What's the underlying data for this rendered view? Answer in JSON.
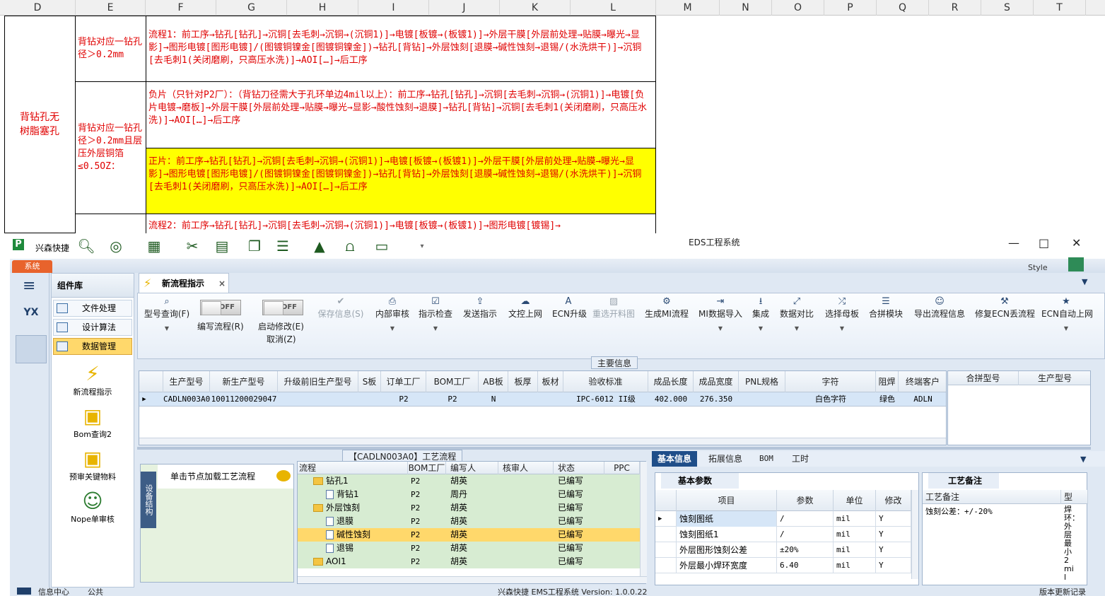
{
  "excel": {
    "columns": [
      "D",
      "E",
      "F",
      "G",
      "H",
      "I",
      "J",
      "K",
      "L",
      "M",
      "N",
      "O",
      "P",
      "Q",
      "R",
      "S",
      "T"
    ],
    "merged_label": "背钻孔无树脂塞孔",
    "rows": [
      {
        "cond": "背钻对应一钻孔径＞0.2mm",
        "flow": "流程1：前工序→钻孔[钻孔]→沉铜[去毛刺→沉铜→(沉铜1)]→电镀[板镀→(板镀1)]→外层干膜[外层前处理→贴膜→曝光→显影]→图形电镀[图形电镀]/(图镀铜镍金[图镀铜镍金])→钻孔[背钻]→外层蚀刻[退膜→碱性蚀刻→退锡/(水洗烘干)]→沉铜[去毛刺1(关闭磨刷，只高压水洗)]→AOI[…]→后工序"
      },
      {
        "cond": "背钻对应一钻孔径＞0.2mm且层压外层铜箔≤0.5OZ：",
        "flow": "负片（只针对P2厂）：（背钻刀径需大于孔环单边4mil以上）：前工序→钻孔[钻孔]→沉铜[去毛刺→沉铜→(沉铜1)]→电镀[负片电镀→磨板]→外层干膜[外层前处理→贴膜→曝光→显影→酸性蚀刻→退膜]→钻孔[背钻]→沉铜[去毛刺1(关闭磨刷，只高压水洗)]→AOI[…]→后工序"
      },
      {
        "cond": "",
        "flow": "正片：前工序→钻孔[钻孔]→沉铜[去毛刺→沉铜→(沉铜1)]→电镀[板镀→(板镀1)]→外层干膜[外层前处理→贴膜→曝光→显影]→图形电镀[图形电镀]/(图镀铜镍金[图镀铜镍金])→钻孔[背钻]→外层蚀刻[退膜→碱性蚀刻→退锡/(水洗烘干)]→沉铜[去毛刺1(关闭磨刷，只高压水洗)]→AOI[…]→后工序"
      },
      {
        "cond": "",
        "flow": "流程2：前工序→钻孔[钻孔]→沉铜[去毛刺→沉铜→(沉铜1)]→电镀[板镀→(板镀1)]→图形电镀[镀锡]→"
      }
    ],
    "highlight_color": "#ffff00",
    "text_color": "#e00000"
  },
  "app": {
    "title": "EDS工程系统",
    "quick_label": "兴森快捷",
    "system_tab": "系统",
    "style_label": "Style",
    "component_lib": "组件库",
    "lib_items": [
      "文件处理",
      "设计算法",
      "数据管理"
    ],
    "lib_tools": [
      "新流程指示",
      "Bom查询2",
      "预审关键物料",
      "Nope单审核"
    ],
    "doc_tab": "新流程指示",
    "toolbar": {
      "query": "型号查询(F)",
      "edit_flow": "编写流程(R)",
      "start_modify": "启动修改(E)",
      "cancel": "取消(Z)",
      "toggle_off": "OFF",
      "buttons": [
        "保存信息(S)",
        "内部审核",
        "指示检查",
        "发送指示",
        "文控上网",
        "ECN升级",
        "重选开料图",
        "生成MI流程",
        "MI数据导入",
        "集成",
        "数据对比",
        "选择母板",
        "合拼模块",
        "导出流程信息",
        "修复ECN丢流程",
        "ECN自动上网"
      ]
    },
    "main_info": "主要信息",
    "main_grid": {
      "headers": [
        "生产型号",
        "新生产型号",
        "升级前旧生产型号",
        "S板",
        "订单工厂",
        "BOM工厂",
        "AB板",
        "板厚",
        "板材",
        "验收标准",
        "成品长度",
        "成品宽度",
        "PNL规格",
        "字符",
        "阻焊",
        "终端客户"
      ],
      "row": [
        "CADLN003A0",
        "10011200029047",
        "",
        "",
        "P2",
        "P2",
        "N",
        "",
        "",
        "IPC-6012 II级",
        "402.000",
        "276.350",
        "",
        "白色字符",
        "绿色",
        "ADLN"
      ]
    },
    "merge_grid": {
      "headers": [
        "合拼型号",
        "生产型号"
      ]
    },
    "flow_title": "【CADLN003A0】工艺流程",
    "device_structure": "设备结构",
    "node_hint": "单击节点加载工艺流程",
    "tree": {
      "headers": [
        "流程",
        "BOM工厂",
        "编写人",
        "核审人",
        "状态",
        "PPC"
      ],
      "rows": [
        {
          "name": "钻孔1",
          "factory": "P2",
          "writer": "胡英",
          "reviewer": "",
          "status": "已编写",
          "level": 0,
          "folder": true
        },
        {
          "name": "背钻1",
          "factory": "P2",
          "writer": "周丹",
          "reviewer": "",
          "status": "已编写",
          "level": 1,
          "folder": false
        },
        {
          "name": "外层蚀刻",
          "factory": "P2",
          "writer": "胡英",
          "reviewer": "",
          "status": "已编写",
          "level": 0,
          "folder": true
        },
        {
          "name": "退膜",
          "factory": "P2",
          "writer": "胡英",
          "reviewer": "",
          "status": "已编写",
          "level": 1,
          "folder": false
        },
        {
          "name": "碱性蚀刻",
          "factory": "P2",
          "writer": "胡英",
          "reviewer": "",
          "status": "已编写",
          "level": 1,
          "folder": false,
          "selected": true
        },
        {
          "name": "退锡",
          "factory": "P2",
          "writer": "胡英",
          "reviewer": "",
          "status": "已编写",
          "level": 1,
          "folder": false
        },
        {
          "name": "AOI1",
          "factory": "P2",
          "writer": "胡英",
          "reviewer": "",
          "status": "已编写",
          "level": 0,
          "folder": true
        }
      ]
    },
    "right_tabs": [
      "基本信息",
      "拓展信息",
      "BOM",
      "工时"
    ],
    "basic_params": "基本参数",
    "params": {
      "headers": [
        "项目",
        "参数",
        "单位",
        "修改"
      ],
      "rows": [
        [
          "蚀刻图纸",
          "/",
          "mil",
          "Y"
        ],
        [
          "蚀刻图纸1",
          "/",
          "mil",
          "Y"
        ],
        [
          "外层图形蚀刻公差",
          "±20%",
          "mil",
          "Y"
        ],
        [
          "外层最小焊环宽度",
          "6.40",
          "mil",
          "Y"
        ]
      ]
    },
    "process_notes_tab": "工艺备注",
    "process_notes_header": "工艺备注",
    "model_header": "型",
    "process_notes_value": "蚀刻公差：+/-20%",
    "side_note": "焊环：外层最小2mil",
    "status_bar": {
      "info": "信息中心",
      "public": "公共",
      "center": "兴森快捷 EMS工程系统 Version: 1.0.0.22",
      "right": "版本更新记录"
    }
  }
}
